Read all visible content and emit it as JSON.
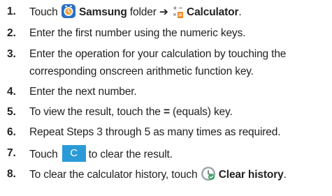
{
  "steps": [
    {
      "number": "1.",
      "parts": {
        "a": "Touch ",
        "b": "Samsung",
        "c": " folder ",
        "arrow": "➔",
        "d": "Calculator",
        "e": "."
      }
    },
    {
      "number": "2.",
      "text": "Enter the first number using the numeric keys."
    },
    {
      "number": "3.",
      "line1": "Enter the operation for your calculation by touching the",
      "line2": "corresponding onscreen arithmetic function key."
    },
    {
      "number": "4.",
      "text": "Enter the next number."
    },
    {
      "number": "5.",
      "parts": {
        "a": "To view the result, touch the ",
        "b": "=",
        "c": " (equals) key."
      }
    },
    {
      "number": "6.",
      "text": "Repeat Steps 3 through 5 as many times as required."
    },
    {
      "number": "7.",
      "parts": {
        "a": "Touch",
        "key": "C",
        "b": "to clear the result."
      }
    },
    {
      "number": "8.",
      "parts": {
        "a": "To clear the calculator history, touch ",
        "b": "Clear history",
        "c": "."
      }
    }
  ],
  "icons": {
    "samsung_folder": "samsung-folder-icon",
    "calculator": "calculator-icon",
    "clear_history": "clear-history-icon"
  },
  "colors": {
    "c_key": "#2a9bd6",
    "calculator_orange": "#f08a1e",
    "clear_history_green": "#3aa564"
  }
}
